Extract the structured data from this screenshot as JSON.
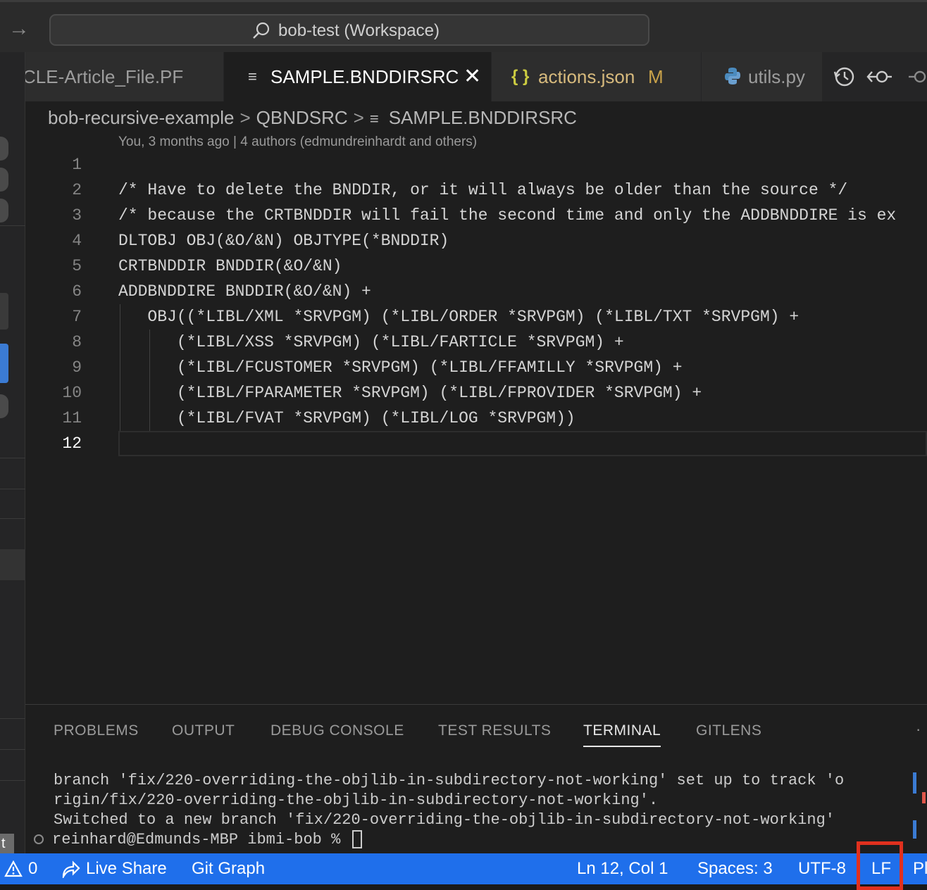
{
  "titlebar": {
    "workspace_label": "bob-test (Workspace)"
  },
  "tabs": [
    {
      "label": "CLE-Article_File.PF"
    },
    {
      "label": "SAMPLE.BNDDIRSRC",
      "icon": "≡",
      "close": "✕"
    },
    {
      "label": "actions.json",
      "icon": "{ }",
      "modified": "M"
    },
    {
      "label": "utils.py"
    }
  ],
  "breadcrumb": {
    "items": [
      "bob-recursive-example",
      "QBNDSRC",
      "SAMPLE.BNDDIRSRC"
    ],
    "separator": ">",
    "file_icon": "≡"
  },
  "blame": "You, 3 months ago | 4 authors (edmundreinhardt and others)",
  "editor": {
    "lines": [
      {
        "n": "1",
        "text": ""
      },
      {
        "n": "2",
        "text": "/* Have to delete the BNDDIR, or it will always be older than the source */"
      },
      {
        "n": "3",
        "text": "/* because the CRTBNDDIR will fail the second time and only the ADDBNDDIRE is ex"
      },
      {
        "n": "4",
        "text": "DLTOBJ OBJ(&O/&N) OBJTYPE(*BNDDIR)"
      },
      {
        "n": "5",
        "text": "CRTBNDDIR BNDDIR(&O/&N)"
      },
      {
        "n": "6",
        "text": "ADDBNDDIRE BNDDIR(&O/&N) +"
      },
      {
        "n": "7",
        "text": "   OBJ((*LIBL/XML *SRVPGM) (*LIBL/ORDER *SRVPGM) (*LIBL/TXT *SRVPGM) +"
      },
      {
        "n": "8",
        "text": "      (*LIBL/XSS *SRVPGM) (*LIBL/FARTICLE *SRVPGM) +"
      },
      {
        "n": "9",
        "text": "      (*LIBL/FCUSTOMER *SRVPGM) (*LIBL/FFAMILLY *SRVPGM) +"
      },
      {
        "n": "10",
        "text": "      (*LIBL/FPARAMETER *SRVPGM) (*LIBL/FPROVIDER *SRVPGM) +"
      },
      {
        "n": "11",
        "text": "      (*LIBL/FVAT *SRVPGM) (*LIBL/LOG *SRVPGM))"
      },
      {
        "n": "12",
        "text": ""
      }
    ]
  },
  "panel": {
    "tabs": [
      "PROBLEMS",
      "OUTPUT",
      "DEBUG CONSOLE",
      "TEST RESULTS",
      "TERMINAL",
      "GITLENS"
    ],
    "active_tab": "TERMINAL",
    "more": "·",
    "terminal_lines": [
      "branch 'fix/220-overriding-the-objlib-in-subdirectory-not-working' set up to track 'o",
      "rigin/fix/220-overriding-the-objlib-in-subdirectory-not-working'.",
      "Switched to a new branch 'fix/220-overriding-the-objlib-in-subdirectory-not-working'"
    ],
    "prompt": "reinhard@Edmunds-MBP ibmi-bob % "
  },
  "statusbar": {
    "problems_count": "0",
    "live_share": "Live Share",
    "git_graph": "Git Graph",
    "position": "Ln 12, Col 1",
    "spaces": "Spaces: 3",
    "encoding": "UTF-8",
    "eol": "LF",
    "language_partial": "Pl"
  },
  "sidebar_edge_text": "t",
  "colors": {
    "statusbar_bg": "#1f6feb",
    "highlight_box": "#e0301e",
    "modified_tab": "#d7ba7d"
  }
}
